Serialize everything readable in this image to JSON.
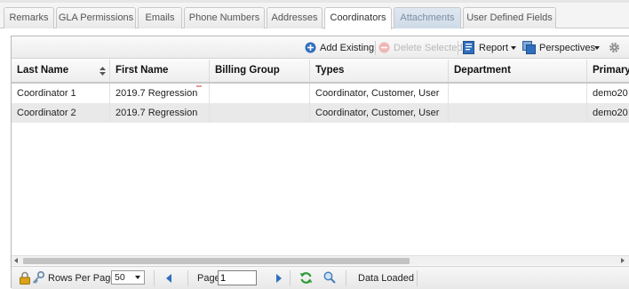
{
  "tabs": [
    {
      "label": "Remarks",
      "state": "normal"
    },
    {
      "label": "GLA Permissions",
      "state": "normal"
    },
    {
      "label": "Emails",
      "state": "normal"
    },
    {
      "label": "Phone Numbers",
      "state": "normal"
    },
    {
      "label": "Addresses",
      "state": "normal"
    },
    {
      "label": "Coordinators",
      "state": "active"
    },
    {
      "label": "Attachments",
      "state": "disabled"
    },
    {
      "label": "User Defined Fields",
      "state": "normal"
    }
  ],
  "toolbar": {
    "add_existing": "Add Existing",
    "delete_selected": "Delete Selected",
    "report": "Report",
    "perspectives": "Perspectives"
  },
  "grid": {
    "columns": [
      "Last Name",
      "First Name",
      "Billing Group",
      "Types",
      "Department",
      "Primary"
    ],
    "rows": [
      [
        "Coordinator 1",
        "2019.7 Regression",
        "",
        "Coordinator, Customer, User",
        "",
        "demo20"
      ],
      [
        "Coordinator 2",
        "2019.7 Regression",
        "",
        "Coordinator, Customer, User",
        "",
        "demo20"
      ]
    ]
  },
  "pager": {
    "rows_per_page_label": "Rows Per Page:",
    "rows_per_page_value": "50",
    "page_label": "Page:",
    "page_value": "1",
    "status": "Data Loaded"
  },
  "colors": {
    "accent_blue": "#2f6fbf",
    "refresh_green": "#2f9a3a",
    "lock_gold": "#d9a21a",
    "header_text": "#111111",
    "alt_row": "#e9e9e9"
  }
}
